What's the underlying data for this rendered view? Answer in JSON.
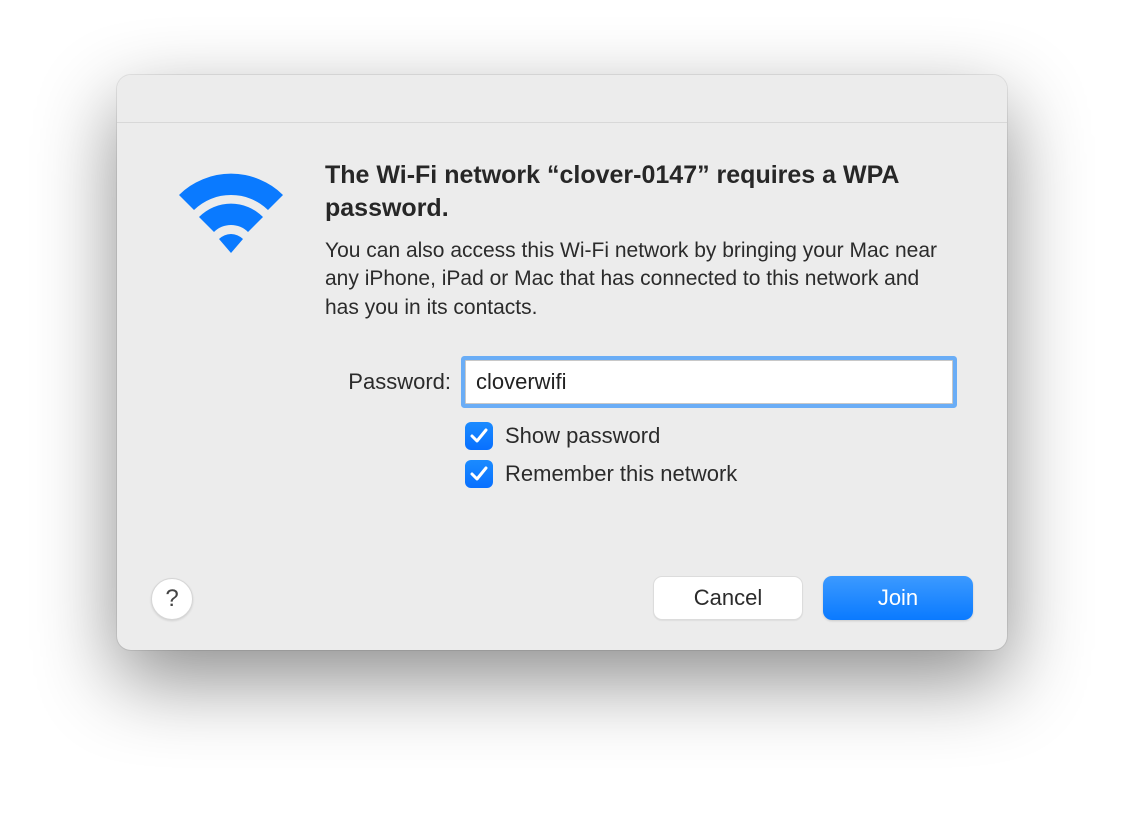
{
  "dialog": {
    "heading": "The Wi-Fi network “clover-0147” requires a WPA password.",
    "subtext": "You can also access this Wi-Fi network by bringing your Mac near any iPhone, iPad or Mac that has connected to this network and has you in its contacts.",
    "password_label": "Password:",
    "password_value": "cloverwifi",
    "show_password_label": "Show password",
    "show_password_checked": true,
    "remember_network_label": "Remember this network",
    "remember_network_checked": true,
    "help_label": "?",
    "cancel_label": "Cancel",
    "join_label": "Join"
  },
  "colors": {
    "accent": "#0a7aff",
    "dialog_bg": "#ececec"
  }
}
